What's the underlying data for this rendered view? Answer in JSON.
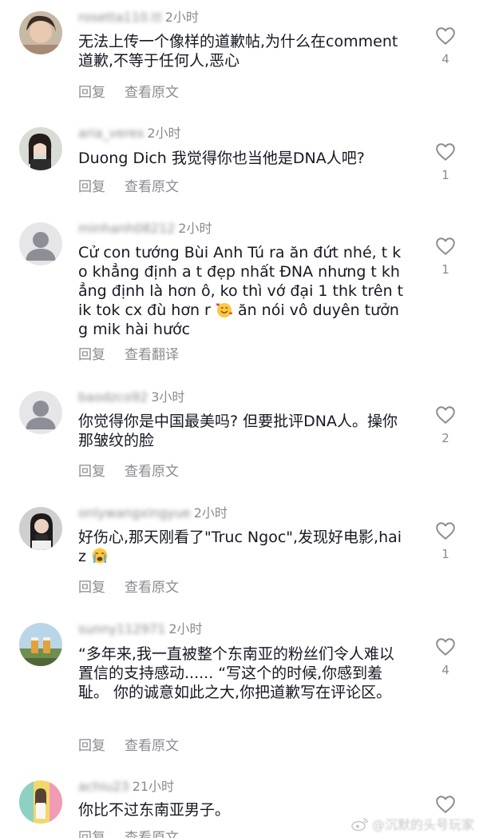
{
  "comments": [
    {
      "username": "rosetta110.tt",
      "time": "2小时",
      "text": "无法上传一个像样的道歉帖,为什么在comment道歉,不等于任何人,恶心",
      "reply": "回复",
      "translate": "查看原文",
      "likes": "4"
    },
    {
      "username": "aria_veres",
      "time": "2小时",
      "text": "Duong Dich 我觉得你也当他是DNA人吧?",
      "reply": "回复",
      "translate": "查看原文",
      "likes": "1"
    },
    {
      "username": "minhanh08212",
      "time": "2小时",
      "text": "Cử con tướng Bùi Anh Tú ra ăn đứt  nhé, t ko khẳng định a t đẹp nhất ĐNA nhưng t khẳng định là hơn ô, ko thì vớ đại 1 thk trên tik tok cx đù hơn r",
      "text_after_emoji": " ăn nói vô duyên tưởng mik hài hước",
      "emoji": "smiling-face-with-hearts",
      "reply": "回复",
      "translate": "查看翻译",
      "likes": "1"
    },
    {
      "username": "baodzco92",
      "time": "3小时",
      "text": "你觉得你是中国最美吗? 但要批评DNA人。操你那皱纹的脸",
      "reply": "回复",
      "translate": "查看原文",
      "likes": "2"
    },
    {
      "username": "onlywangxingyue",
      "time": "2小时",
      "text": "好伤心,那天刚看了\"Truc Ngoc\",发现好电影,haiz",
      "emoji": "loudly-crying-face",
      "reply": "回复",
      "translate": "查看原文",
      "likes": "1"
    },
    {
      "username": "sunny112971",
      "time": "2小时",
      "text": "“多年来,我一直被整个东南亚的粉丝们令人难以置信的支持感动...... “写这个的时候,你感到羞耻。 你的诚意如此之大,你把道歉写在评论区。",
      "reply": "回复",
      "translate": "查看原文",
      "likes": "4"
    },
    {
      "username": "achiu23",
      "time": "21小时",
      "text": "你比不过东南亚男子。",
      "reply": "回复",
      "translate": "查看原文",
      "likes": ""
    }
  ],
  "watermark": "@沉默的头号玩家",
  "colors": {
    "text": "#161823",
    "secondary": "#8a8b91",
    "background": "#ffffff"
  }
}
